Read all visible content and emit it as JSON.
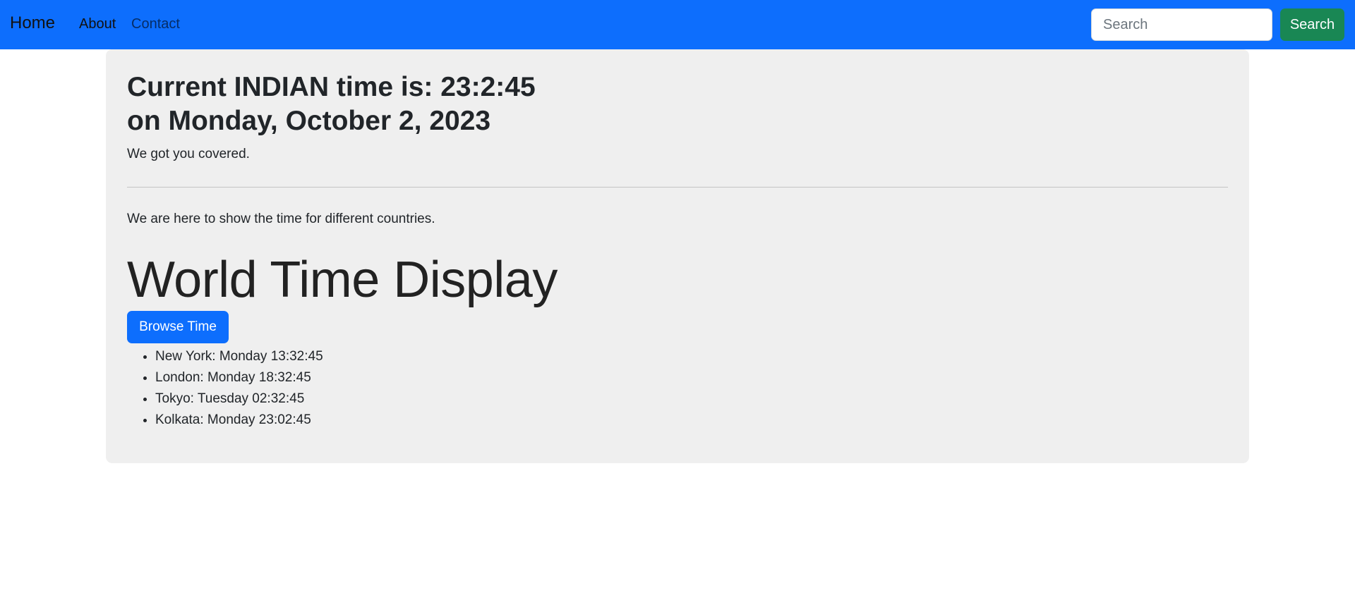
{
  "navbar": {
    "brand": "Home",
    "links": [
      "About",
      "Contact"
    ],
    "search": {
      "placeholder": "Search",
      "value": "",
      "button_label": "Search"
    },
    "color": "#0d6efd"
  },
  "main": {
    "heading_line1": "Current INDIAN time is: 23:2:45",
    "heading_line2": "on Monday, October 2, 2023",
    "tagline": "We got you covered.",
    "intro": "We are here to show the time for different countries.",
    "display_title": "World Time Display",
    "browse_button": "Browse Time",
    "times": [
      "New York: Monday 13:32:45",
      "London: Monday 18:32:45",
      "Tokyo: Tuesday 02:32:45",
      "Kolkata: Monday 23:02:45"
    ]
  }
}
